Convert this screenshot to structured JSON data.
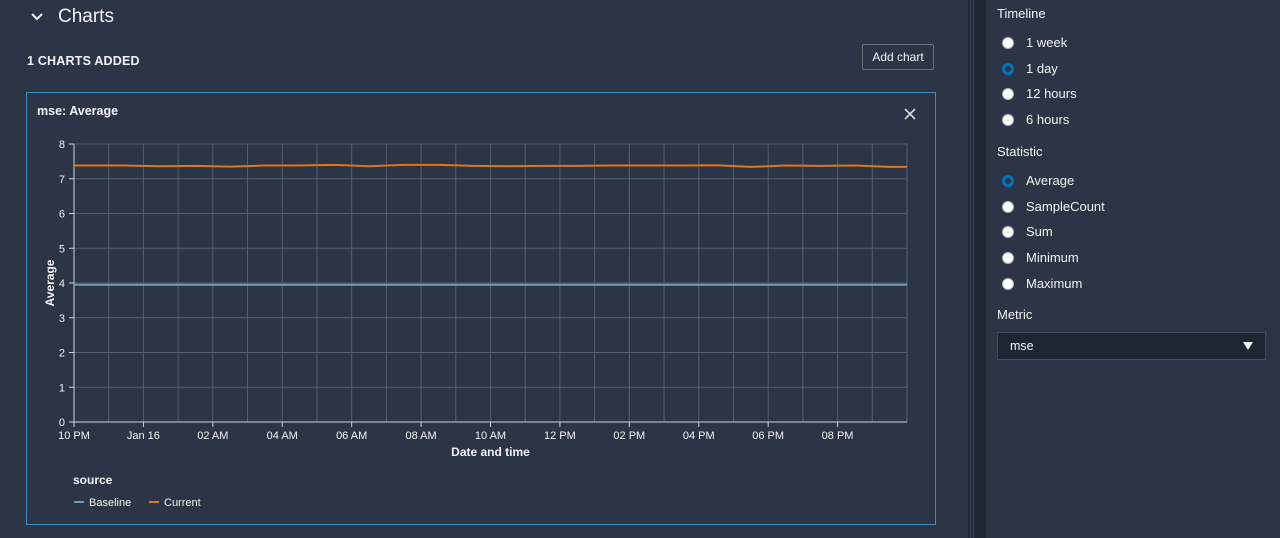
{
  "charts_section": {
    "title": "Charts",
    "count_label": "1 CHARTS ADDED",
    "add_chart_label": "Add chart"
  },
  "chart_card": {
    "title": "mse: Average"
  },
  "chart_data": {
    "type": "line",
    "title": "mse: Average",
    "xlabel": "Date and time",
    "ylabel": "Average",
    "ylim": [
      0,
      8
    ],
    "yticks": [
      "0",
      "1",
      "2",
      "3",
      "4",
      "5",
      "6",
      "7",
      "8"
    ],
    "xticks": [
      "10 PM",
      "Jan 16",
      "02 AM",
      "04 AM",
      "06 AM",
      "08 AM",
      "10 AM",
      "12 PM",
      "02 PM",
      "04 PM",
      "06 PM",
      "08 PM"
    ],
    "grid": true,
    "legend_title": "source",
    "legend_position": "bottom-left",
    "series": [
      {
        "name": "Baseline",
        "color": "#6c9fb4",
        "x": [
          "10 PM",
          "11 PM",
          "Jan 16",
          "01 AM",
          "02 AM",
          "03 AM",
          "04 AM",
          "05 AM",
          "06 AM",
          "07 AM",
          "08 AM",
          "09 AM",
          "10 AM",
          "11 AM",
          "12 PM",
          "01 PM",
          "02 PM",
          "03 PM",
          "04 PM",
          "05 PM",
          "06 PM",
          "07 PM",
          "08 PM",
          "09 PM"
        ],
        "values": [
          3.95,
          3.95,
          3.95,
          3.95,
          3.95,
          3.95,
          3.95,
          3.95,
          3.95,
          3.95,
          3.95,
          3.95,
          3.95,
          3.95,
          3.95,
          3.95,
          3.95,
          3.95,
          3.95,
          3.95,
          3.95,
          3.95,
          3.95,
          3.95
        ]
      },
      {
        "name": "Current",
        "color": "#ec7211",
        "x": [
          "10 PM",
          "11 PM",
          "Jan 16",
          "01 AM",
          "02 AM",
          "03 AM",
          "04 AM",
          "05 AM",
          "06 AM",
          "07 AM",
          "08 AM",
          "09 AM",
          "10 AM",
          "11 AM",
          "12 PM",
          "01 PM",
          "02 PM",
          "03 PM",
          "04 PM",
          "05 PM",
          "06 PM",
          "07 PM",
          "08 PM",
          "09 PM"
        ],
        "values": [
          7.38,
          7.38,
          7.36,
          7.37,
          7.35,
          7.38,
          7.38,
          7.4,
          7.36,
          7.4,
          7.4,
          7.37,
          7.36,
          7.37,
          7.37,
          7.38,
          7.38,
          7.38,
          7.39,
          7.34,
          7.38,
          7.37,
          7.38,
          7.34
        ]
      }
    ]
  },
  "sidebar": {
    "timeline": {
      "label": "Timeline",
      "options": [
        "1 week",
        "1 day",
        "12 hours",
        "6 hours"
      ],
      "selected": "1 day"
    },
    "statistic": {
      "label": "Statistic",
      "options": [
        "Average",
        "SampleCount",
        "Sum",
        "Minimum",
        "Maximum"
      ],
      "selected": "Average"
    },
    "metric": {
      "label": "Metric",
      "value": "mse"
    }
  },
  "colors": {
    "background": "#2c3545",
    "accent": "#0073bb",
    "card_border": "#3a8fc9",
    "current_series": "#ec7211",
    "baseline_series": "#6c9fb4"
  },
  "icons": {
    "section_toggle": "chevron-down-icon",
    "close": "close-icon",
    "dropdown": "caret-down-icon"
  }
}
